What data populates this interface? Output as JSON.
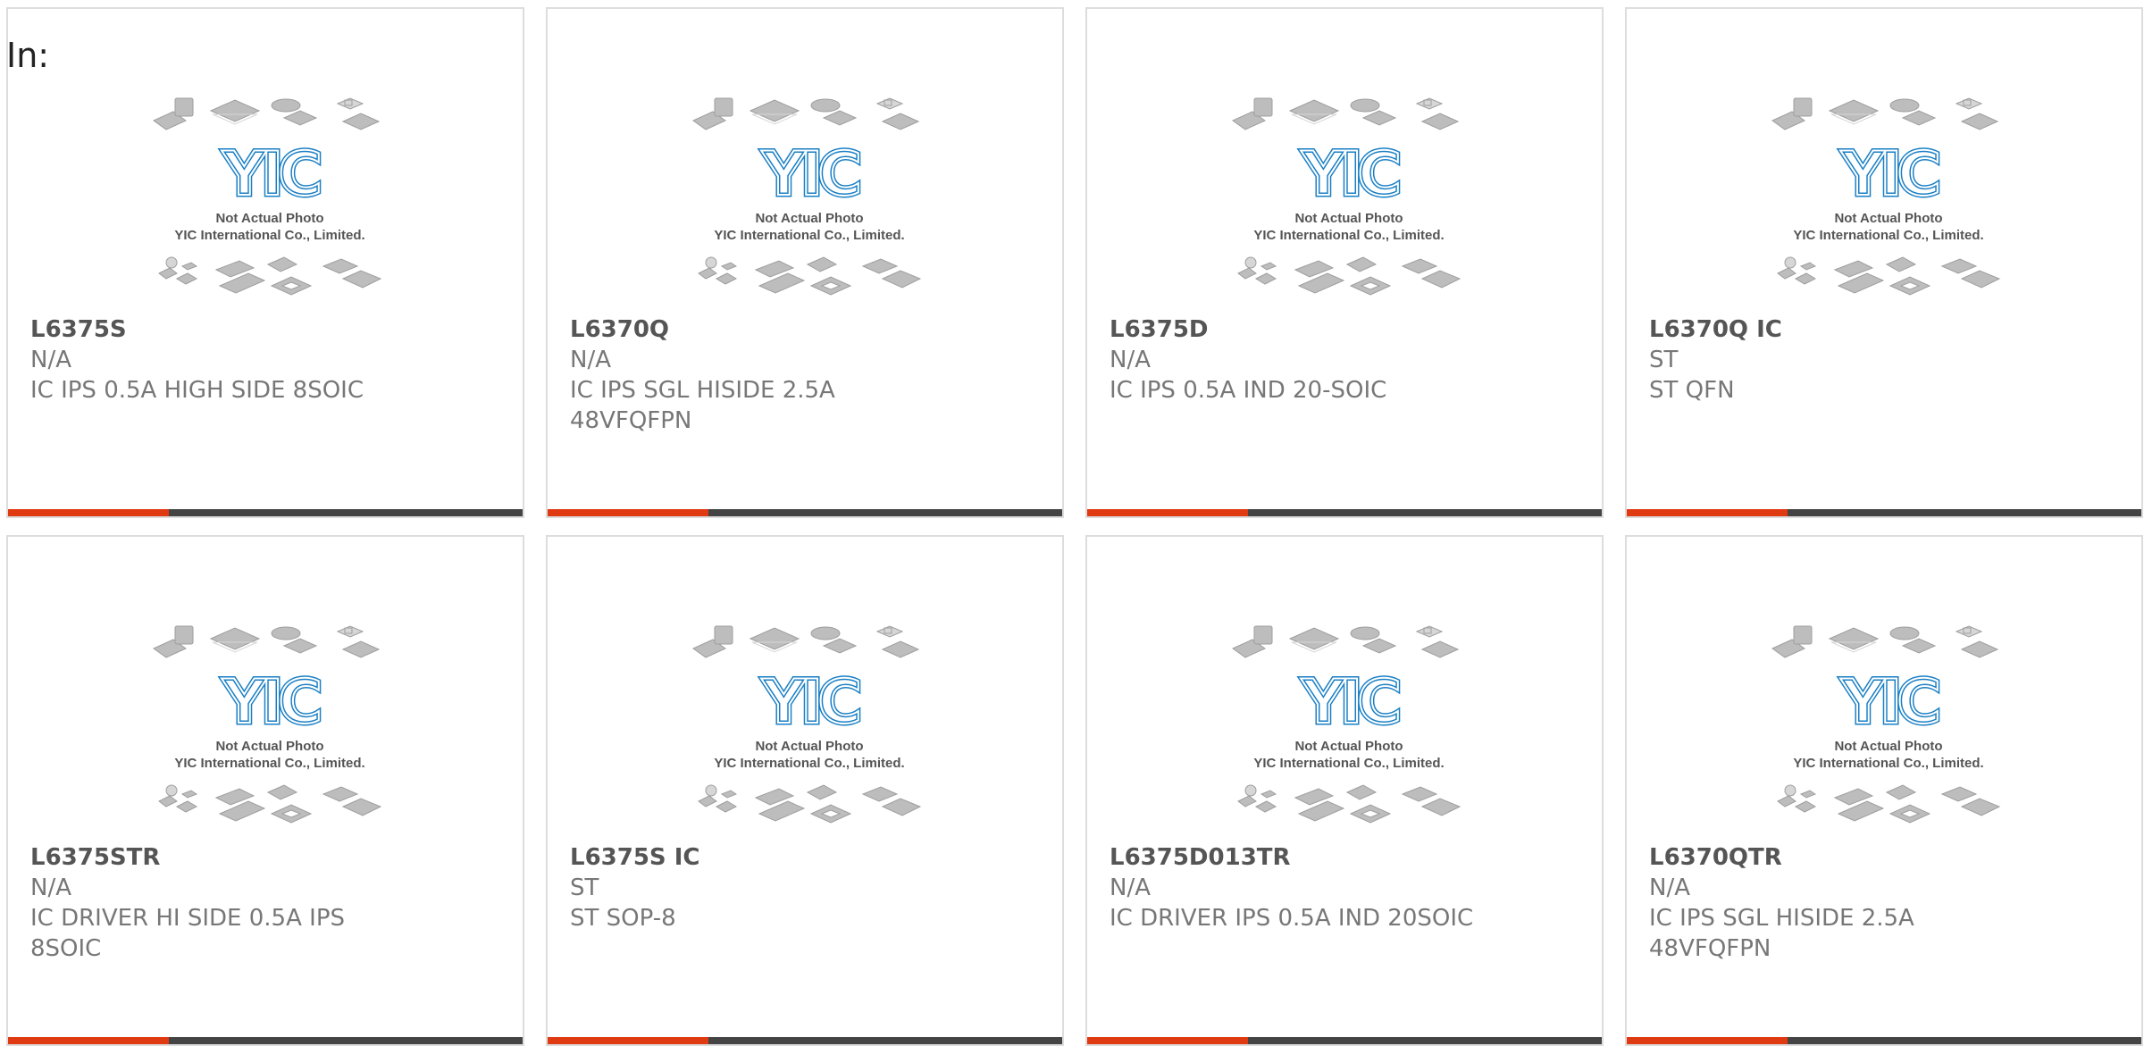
{
  "heading": "In:",
  "colors": {
    "accent": "#e03a12",
    "bar": "#444444",
    "border": "#dddddd",
    "logo": "#1a7fc4"
  },
  "placeholder_image": {
    "icon": "chip-package-placeholder-icon",
    "logo_text": "YIC",
    "line1": "Not Actual Photo",
    "line2": "YIC International Co., Limited."
  },
  "products": [
    {
      "part_no": "L6375S",
      "maker": "N/A",
      "description": "IC IPS 0.5A HIGH SIDE 8SOIC"
    },
    {
      "part_no": "L6370Q",
      "maker": "N/A",
      "description": "IC IPS SGL HISIDE 2.5A 48VFQFPN"
    },
    {
      "part_no": "L6375D",
      "maker": "N/A",
      "description": "IC IPS 0.5A IND 20-SOIC"
    },
    {
      "part_no": "L6370Q IC",
      "maker": "ST",
      "description": "ST QFN"
    },
    {
      "part_no": "L6375STR",
      "maker": "N/A",
      "description": "IC DRIVER HI SIDE 0.5A IPS 8SOIC"
    },
    {
      "part_no": "L6375S IC",
      "maker": "ST",
      "description": "ST SOP-8"
    },
    {
      "part_no": "L6375D013TR",
      "maker": "N/A",
      "description": "IC DRIVER IPS 0.5A IND 20SOIC"
    },
    {
      "part_no": "L6370QTR",
      "maker": "N/A",
      "description": "IC IPS SGL HISIDE 2.5A 48VFQFPN"
    }
  ]
}
